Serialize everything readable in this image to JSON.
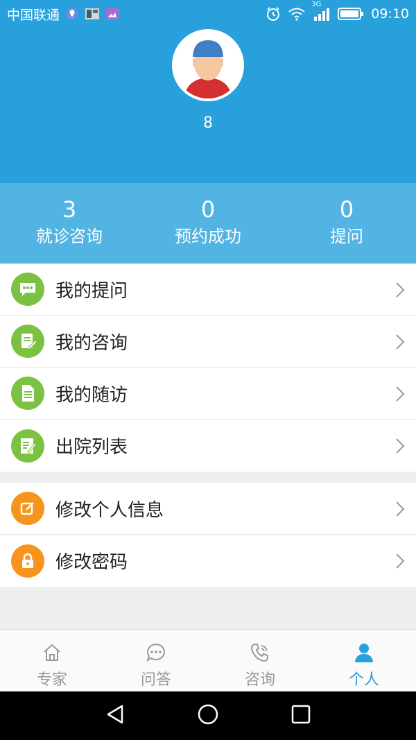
{
  "status_bar": {
    "carrier": "中国联通",
    "network": "3G",
    "time": "09:10",
    "icons": [
      "location-icon",
      "image-icon",
      "gallery-icon",
      "alarm-icon",
      "wifi-icon",
      "signal-icon",
      "battery-icon"
    ]
  },
  "profile": {
    "avatar_icon": "user-avatar",
    "username": "8"
  },
  "stats": [
    {
      "value": "3",
      "label": "就诊咨询"
    },
    {
      "value": "0",
      "label": "预约成功"
    },
    {
      "value": "0",
      "label": "提问"
    }
  ],
  "menu_group_1": [
    {
      "label": "我的提问",
      "icon": "chat-bubble-icon",
      "color": "#7cc242"
    },
    {
      "label": "我的咨询",
      "icon": "edit-document-icon",
      "color": "#7cc242"
    },
    {
      "label": "我的随访",
      "icon": "document-icon",
      "color": "#7cc242"
    },
    {
      "label": "出院列表",
      "icon": "discharge-list-icon",
      "color": "#7cc242"
    }
  ],
  "menu_group_2": [
    {
      "label": "修改个人信息",
      "icon": "edit-icon",
      "color": "#f7941d"
    },
    {
      "label": "修改密码",
      "icon": "lock-icon",
      "color": "#f7941d"
    }
  ],
  "tabs": [
    {
      "label": "专家",
      "icon": "home-icon",
      "active": false
    },
    {
      "label": "问答",
      "icon": "chat-icon",
      "active": false
    },
    {
      "label": "咨询",
      "icon": "phone-icon",
      "active": false
    },
    {
      "label": "个人",
      "icon": "person-icon",
      "active": true
    }
  ],
  "nav_bar": {
    "icons": [
      "back-icon",
      "home-circle-icon",
      "recents-icon"
    ]
  },
  "colors": {
    "primary": "#27a0dc",
    "stats_bg": "#52b4e3",
    "green": "#7cc242",
    "orange": "#f7941d",
    "inactive_tab": "#999999"
  }
}
